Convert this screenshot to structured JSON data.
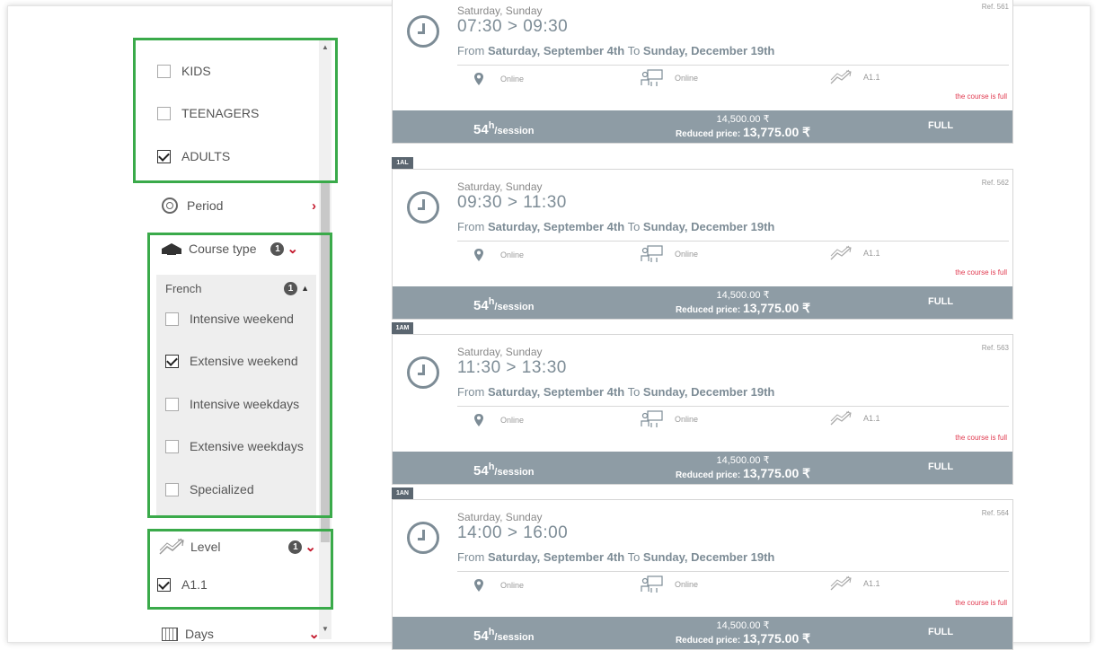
{
  "filters": {
    "audience": [
      {
        "label": "KIDS",
        "checked": false
      },
      {
        "label": "TEENAGERS",
        "checked": false
      },
      {
        "label": "ADULTS",
        "checked": true
      }
    ],
    "period": {
      "label": "Period"
    },
    "course_type": {
      "label": "Course type",
      "count": "1"
    },
    "french": {
      "label": "French",
      "count": "1"
    },
    "course_options": [
      {
        "label": "Intensive weekend",
        "checked": false
      },
      {
        "label": "Extensive weekend",
        "checked": true
      },
      {
        "label": "Intensive weekdays",
        "checked": false
      },
      {
        "label": "Extensive weekdays",
        "checked": false
      },
      {
        "label": "Specialized",
        "checked": false
      }
    ],
    "level": {
      "label": "Level",
      "count": "1"
    },
    "level_options": [
      {
        "label": "A1.1",
        "checked": true
      }
    ],
    "days": {
      "label": "Days"
    }
  },
  "courses": [
    {
      "tag": "",
      "days": "Saturday, Sunday",
      "ref": "Ref. 561",
      "time": "07:30 > 09:30",
      "from_prefix": "From",
      "from": "Saturday, September 4th",
      "to_prefix": "To",
      "to": "Sunday, December 19th",
      "location": "Online",
      "mode": "Online",
      "level": "A1.1",
      "note": "the course is full",
      "hours": "54",
      "hours_unit": "h",
      "per": "/session",
      "price": "14,500.00 ₹",
      "reduced_label": "Reduced price:",
      "reduced": "13,775.00 ₹",
      "status": "FULL"
    },
    {
      "tag": "1AL",
      "days": "Saturday, Sunday",
      "ref": "Ref. 562",
      "time": "09:30 > 11:30",
      "from_prefix": "From",
      "from": "Saturday, September 4th",
      "to_prefix": "To",
      "to": "Sunday, December 19th",
      "location": "Online",
      "mode": "Online",
      "level": "A1.1",
      "note": "the course is full",
      "hours": "54",
      "hours_unit": "h",
      "per": "/session",
      "price": "14,500.00 ₹",
      "reduced_label": "Reduced price:",
      "reduced": "13,775.00 ₹",
      "status": "FULL"
    },
    {
      "tag": "1AM",
      "days": "Saturday, Sunday",
      "ref": "Ref. 563",
      "time": "11:30 > 13:30",
      "from_prefix": "From",
      "from": "Saturday, September 4th",
      "to_prefix": "To",
      "to": "Sunday, December 19th",
      "location": "Online",
      "mode": "Online",
      "level": "A1.1",
      "note": "the course is full",
      "hours": "54",
      "hours_unit": "h",
      "per": "/session",
      "price": "14,500.00 ₹",
      "reduced_label": "Reduced price:",
      "reduced": "13,775.00 ₹",
      "status": "FULL"
    },
    {
      "tag": "1AN",
      "days": "Saturday, Sunday",
      "ref": "Ref. 564",
      "time": "14:00 > 16:00",
      "from_prefix": "From",
      "from": "Saturday, September 4th",
      "to_prefix": "To",
      "to": "Sunday, December 19th",
      "location": "Online",
      "mode": "Online",
      "level": "A1.1",
      "note": "the course is full",
      "hours": "54",
      "hours_unit": "h",
      "per": "/session",
      "price": "14,500.00 ₹",
      "reduced_label": "Reduced price:",
      "reduced": "13,775.00 ₹",
      "status": "FULL"
    }
  ],
  "colors": {
    "highlight": "#3aaa4a",
    "accent": "#c41a2e",
    "bar": "#8e9ca5",
    "full_note": "#e0394f"
  }
}
